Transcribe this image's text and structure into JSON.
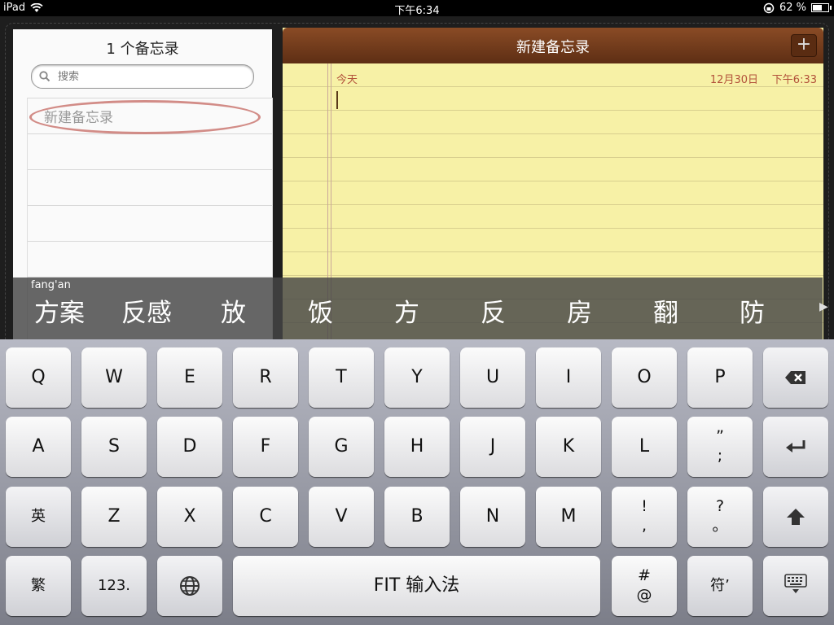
{
  "status": {
    "device": "iPad",
    "time": "下午6:34",
    "battery": "62 %",
    "battery_fraction": 0.62
  },
  "list": {
    "count_label": "1 个备忘录",
    "search_placeholder": "搜索",
    "items": [
      {
        "title": "新建备忘录"
      }
    ]
  },
  "note": {
    "title": "新建备忘录",
    "add_label": "+",
    "today_label": "今天",
    "date": "12月30日",
    "time": "下午6:33"
  },
  "candidates": {
    "pinyin": "fang'an",
    "words": [
      "方案",
      "反感",
      "放",
      "饭",
      "方",
      "反",
      "房",
      "翻",
      "防"
    ]
  },
  "keyboard": {
    "row1": [
      "Q",
      "W",
      "E",
      "R",
      "T",
      "Y",
      "U",
      "I",
      "O",
      "P"
    ],
    "row2": [
      "A",
      "S",
      "D",
      "F",
      "G",
      "H",
      "J",
      "K",
      "L"
    ],
    "row2_punct": {
      "top": "”",
      "bottom": ";"
    },
    "row3_lang": "英",
    "row3": [
      "Z",
      "X",
      "C",
      "V",
      "B",
      "N",
      "M"
    ],
    "row3_punct1": {
      "top": "!",
      "bottom": ","
    },
    "row3_punct2": {
      "top": "?",
      "bottom": "。"
    },
    "row4": {
      "trad": "繁",
      "numbers": "123.",
      "space": "FIT 输入法",
      "hash_top": "#",
      "hash_bottom": "@",
      "symbol": "符’"
    }
  }
}
